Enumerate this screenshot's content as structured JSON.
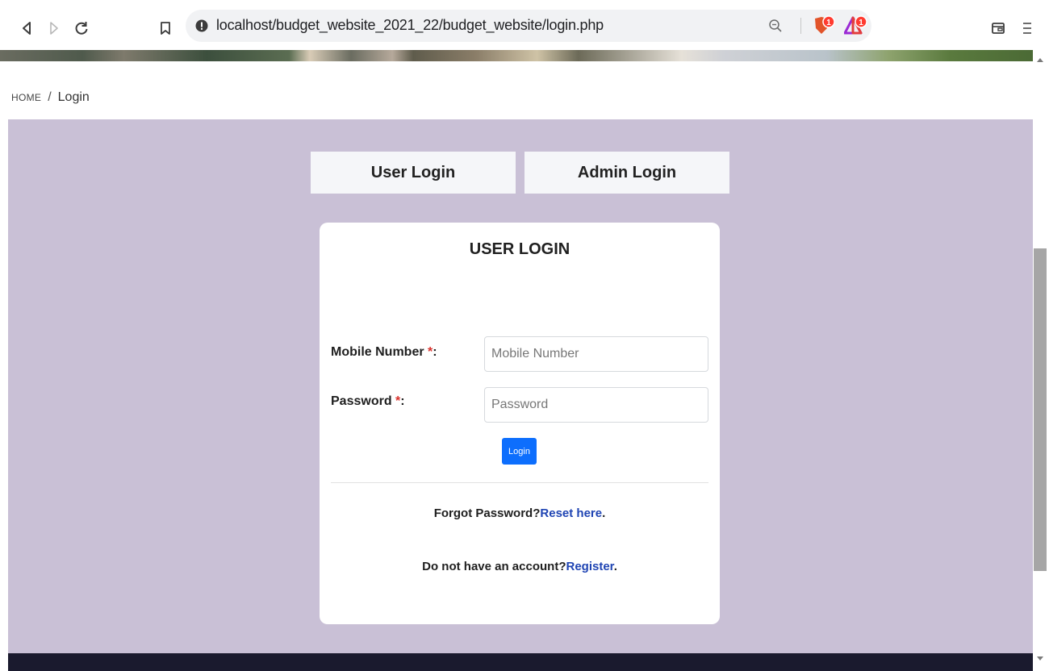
{
  "browser": {
    "url": "localhost/budget_website_2021_22/budget_website/login.php",
    "icons": [
      "back-icon",
      "forward-icon",
      "reload-icon",
      "bookmark-icon",
      "site-info-icon",
      "zoom-icon",
      "brave-shields-icon",
      "brave-rewards-icon",
      "wallet-icon",
      "menu-icon"
    ],
    "shields_badge": "1",
    "rewards_badge": "1"
  },
  "breadcrumb": {
    "home": "HOME",
    "separator": "/",
    "current": "Login"
  },
  "tabs": {
    "user_login": "User Login",
    "admin_login": "Admin Login"
  },
  "login_card": {
    "title": "USER LOGIN",
    "mobile_label": "Mobile Number ",
    "password_label": "Password ",
    "required_mark": "*",
    "label_suffix": ":",
    "mobile_placeholder": "Mobile Number",
    "password_placeholder": "Password",
    "login_button": "Login",
    "forgot_text": "Forgot Password?",
    "reset_link": "Reset here",
    "no_account_text": "Do not have an account?",
    "register_link": "Register",
    "period": "."
  },
  "colors": {
    "page_background": "#c9c0d6",
    "primary_button": "#0d6efd",
    "link": "#1f44b3",
    "required": "#d9312b",
    "footer": "#1a1a2e"
  }
}
